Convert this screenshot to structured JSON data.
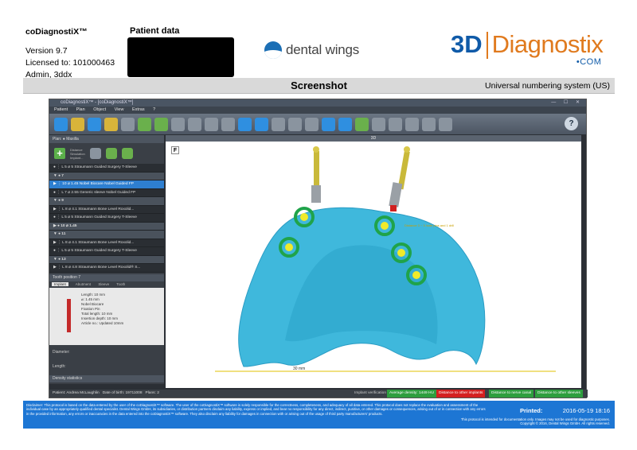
{
  "header": {
    "app_name": "coDiagnostiX™",
    "version": "Version 9.7",
    "license": "Licensed to: 101000463",
    "user": "Admin, 3ddx",
    "patient_label": "Patient data",
    "dw_logo": "dental wings",
    "dd_logo_3d": "3D",
    "dd_logo_name": "Diagnostix",
    "dd_logo_com": "•COM"
  },
  "title_bar": {
    "title": "Screenshot",
    "numbering": "Universal numbering system (US)"
  },
  "app_window": {
    "window_title": "coDiagnostiX™ - [coDiagnostiX™]",
    "menu": [
      "Patient",
      "Plan",
      "Object",
      "View",
      "Extras",
      "?"
    ],
    "left_panel": {
      "plan_label": "Plan: ● Maxilla",
      "tool_hints": [
        "Distance",
        "Simulation",
        "Implant..."
      ],
      "rows": [
        {
          "text": "●  ⋮  L  5  ⌀ 5  Straumann Guided Surgery T-Sleeve",
          "type": "item"
        },
        {
          "text": "▼  ●  7",
          "type": "grp"
        },
        {
          "text": "▶  ⋮  10  ⌀ 1.45  Nobel Biocare Nobel Guided FP",
          "type": "sel"
        },
        {
          "text": "●  ⋮  L  7  ⌀ 2.55  Generic sleeve Nobel Guided FP",
          "type": "item"
        },
        {
          "text": "▼  ●  9",
          "type": "grp"
        },
        {
          "text": "▶  ⋮  L  8  ⌀ 4.1  Straumann Bone Level Roxolid...",
          "type": "item"
        },
        {
          "text": "●  ⋮  L  5  ⌀ 5  Straumann Guided Surgery T-Sleeve",
          "type": "item"
        },
        {
          "text": "▶  ●  10  ⌀ 1.45",
          "type": "grp"
        },
        {
          "text": "▼  ●  11",
          "type": "grp"
        },
        {
          "text": "▶  ⋮  L  8  ⌀ 4.1  Straumann Bone Level Roxolid...",
          "type": "item"
        },
        {
          "text": "●  ⋮  L  5  ⌀ 5  Straumann Guided Surgery T-Sleeve",
          "type": "item"
        },
        {
          "text": "▼  ●  13",
          "type": "grp"
        },
        {
          "text": "▶  ⋮  L  8  ⌀ 4.8  Straumann Bone Level Roxolid® S...",
          "type": "item"
        }
      ],
      "tooth_position_label": "Tooth position 7",
      "tabs": [
        "Implant",
        "Abutment",
        "Sleeve",
        "Tooth"
      ],
      "detail_lines": [
        "Length: 10 mm",
        "⌀: 1.45 mm",
        "Nobel Biocare",
        "Fixation Pin",
        "Total length: 10 mm",
        "Insertion depth: 10 mm",
        "Article no.: Updated 10mm"
      ],
      "diameter_label": "Diameter:",
      "length_label": "Length:",
      "density_label": "Density statistics"
    },
    "viewport": {
      "label": "3D",
      "corner_letter": "F",
      "scale_label": "30 mm",
      "annotation": "Distance 3 ~ 3 /side pins and 1 drill"
    },
    "status": {
      "patient_label": "Patient:",
      "patient_name": "Andrea McLaughlin",
      "dob_label": "Date of birth:",
      "dob": "19711008",
      "plans_label": "Plans:",
      "plans": "2",
      "verification": "Implant verification",
      "avg_density": "Average density: 1449 HU",
      "dist_implants": "Distance to other implants",
      "dist_canal": "Distance to nerve canal",
      "dist_sleeves": "Distance to other sleeves"
    }
  },
  "disclaimer": {
    "text": "Disclaimer: This protocol is based on the data entered by the user of the coDiagnostiX™ software. The user of the coDiagnostiX™ software is solely responsible for the correctness, completeness, and adequacy of all data entered. This protocol does not replace the evaluation and assessment of the individual case by an appropriately qualified dental specialist. Dental Wings GmbH, its subsidiaries, or distribution partners disclaim any liability, express or implied, and bear no responsibility for any direct, indirect, punitive, or other damages or consequences, arising out of or in connection with any errors in the provided information, any errors or inaccuracies in the data entered into the coDiagnostiX™ software. They also disclaim any liability for damages in connection with or arising out of the usage of third party manufacturers' products.",
    "printed_label": "Printed:",
    "printed_value": "2016-05-19  18:16",
    "note": "This protocol is intended for documentation only. Images may not be used for diagnostic purposes.",
    "copyright": "Copyright © 2016, Dental Wings GmbH. All rights reserved."
  },
  "colors": {
    "accent_blue": "#1d76d4",
    "logo_orange": "#e07a1e",
    "scan_cyan": "#3fb8dc",
    "implant_green": "#1fa34a"
  }
}
